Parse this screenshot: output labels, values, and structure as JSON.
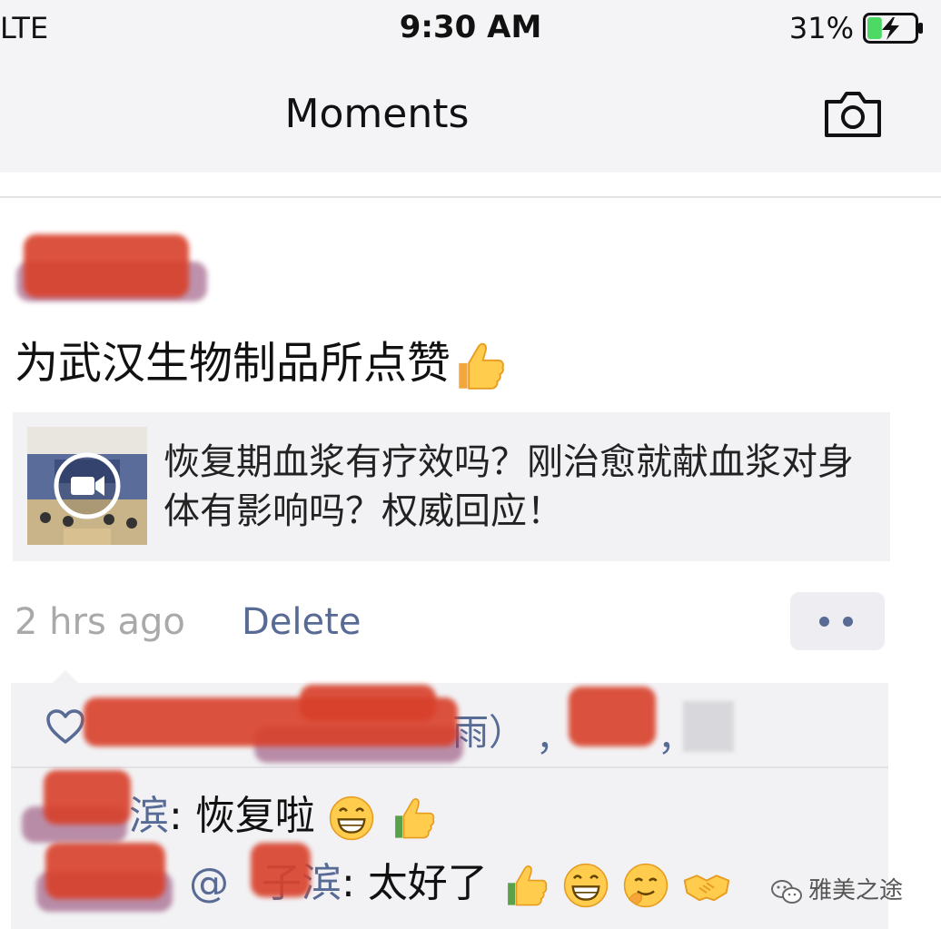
{
  "status_bar": {
    "carrier": "LTE",
    "time": "9:30 AM",
    "battery_percent": "31%",
    "battery_level": 0.31,
    "charging": true
  },
  "nav": {
    "title": "Moments",
    "camera_icon": "camera-icon"
  },
  "post": {
    "text": "为武汉生物制品所点赞",
    "text_emoji": "thumbs-up-emoji",
    "link_card": {
      "thumbnail_icon": "video-play-icon",
      "title": "恢复期血浆有疗效吗？刚治愈就献血浆对身体有影响吗？权威回应！"
    },
    "time_ago": "2 hrs ago",
    "delete_label": "Delete",
    "more_icon": "more-dots-icon"
  },
  "interactions": {
    "like_icon": "heart-icon",
    "likes_visible_fragments": [
      "雨）",
      "，",
      "，"
    ],
    "comments": [
      {
        "author_visible": "滨",
        "separator": ": ",
        "text": "恢复啦",
        "emojis": [
          "grinning-emoji",
          "thumbs-up-emoji"
        ]
      },
      {
        "reply_to_prefix": "@",
        "reply_to_visible": "子滨",
        "separator": ": ",
        "text": "太好了",
        "emojis": [
          "thumbs-up-emoji",
          "grinning-emoji",
          "thinking-emoji",
          "handshake-emoji"
        ]
      }
    ]
  },
  "watermark": {
    "text": "雅美之途",
    "icon": "wechat-icon"
  },
  "colors": {
    "link_blue": "#576b95",
    "meta_gray": "#a9a9a9",
    "card_bg": "#f2f2f4",
    "battery_green": "#4cd964",
    "redaction": "#d8402a"
  }
}
